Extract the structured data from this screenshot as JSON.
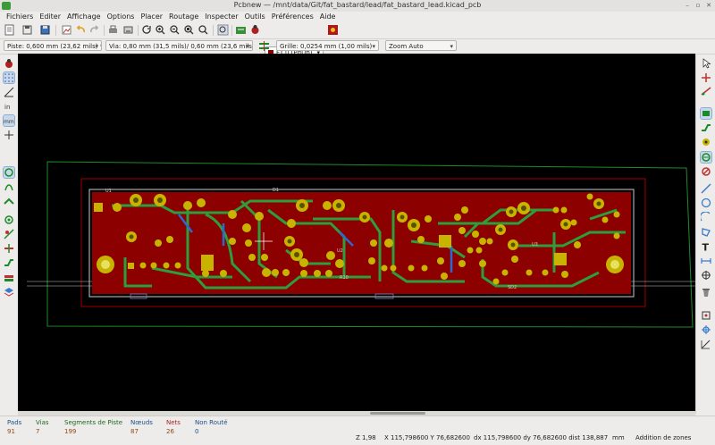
{
  "window": {
    "title": "Pcbnew — /mnt/data/Git/fat_bastard/lead/fat_bastard_lead.kicad_pcb"
  },
  "menu": [
    "Fichiers",
    "Editer",
    "Affichage",
    "Options",
    "Placer",
    "Routage",
    "Inspecter",
    "Outils",
    "Préférences",
    "Aide"
  ],
  "toolbar": {
    "layer": "F.Cu (PgUp)",
    "layer_color": "#8b0000",
    "track_width": "Piste: 0,600 mm (23,62 mils) *",
    "via_size": "Via: 0,80 mm (31,5 mils)/ 0,60 mm (23,6 mils) *",
    "grid": "Grille: 0,0254 mm (1,00 mils)",
    "zoom": "Zoom Auto"
  },
  "board": {
    "silk_labels": [
      "U1",
      "D1",
      "U2",
      "U3",
      "R10",
      "SD2"
    ],
    "colors": {
      "copper": "#8c0000",
      "track": "#2e9d3b",
      "pad": "#c8b400",
      "edge": "#c8c8c8",
      "zone": "#1e8c28"
    }
  },
  "status": {
    "pads_label": "Pads",
    "pads": "91",
    "vias_label": "Vias",
    "vias": "7",
    "segments_label": "Segments de Piste",
    "segments": "199",
    "nodes_label": "Nœuds",
    "nodes": "87",
    "nets_label": "Nets",
    "nets": "26",
    "unrouted_label": "Non Routé",
    "unrouted": "0",
    "zoom": "Z 1,98",
    "xy": "X 115,798600  Y 76,682600",
    "dxdy": "dx 115,798600  dy 76,682600  dist 138,887",
    "unit": "mm",
    "mode": "Addition de zones"
  }
}
